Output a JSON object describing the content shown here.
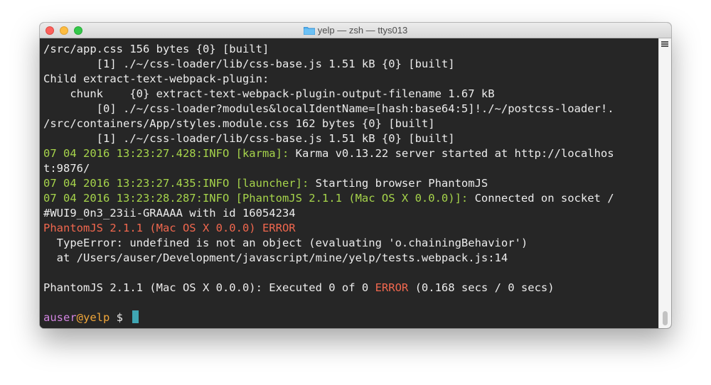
{
  "window": {
    "title": "yelp — zsh — ttys013",
    "colors": {
      "background": "#262626",
      "foreground": "#ececec",
      "green": "#a6d44b",
      "red": "#f0674e",
      "magenta": "#d184e0",
      "yellow": "#f0a63a",
      "cursor": "#3fa6b3"
    }
  },
  "terminal": {
    "lines": [
      [
        {
          "t": "/src/app.css 156 bytes {0} [built]"
        }
      ],
      [
        {
          "t": "        [1] ./~/css-loader/lib/css-base.js 1.51 kB {0} [built]"
        }
      ],
      [
        {
          "t": "Child extract-text-webpack-plugin:"
        }
      ],
      [
        {
          "t": "    chunk    {0} extract-text-webpack-plugin-output-filename 1.67 kB"
        }
      ],
      [
        {
          "t": "        [0] ./~/css-loader?modules&localIdentName=[hash:base64:5]!./~/postcss-loader!."
        }
      ],
      [
        {
          "t": "/src/containers/App/styles.module.css 162 bytes {0} [built]"
        }
      ],
      [
        {
          "t": "        [1] ./~/css-loader/lib/css-base.js 1.51 kB {0} [built]"
        }
      ],
      [
        {
          "t": "07 04 2016 13:23:27.428:INFO [karma]:",
          "c": "green"
        },
        {
          "t": " Karma v0.13.22 server started at http://localhos"
        }
      ],
      [
        {
          "t": "t:9876/"
        }
      ],
      [
        {
          "t": "07 04 2016 13:23:27.435:INFO [launcher]:",
          "c": "green"
        },
        {
          "t": " Starting browser PhantomJS"
        }
      ],
      [
        {
          "t": "07 04 2016 13:23:28.287:INFO [PhantomJS 2.1.1 (Mac OS X 0.0.0)]:",
          "c": "green"
        },
        {
          "t": " Connected on socket /"
        }
      ],
      [
        {
          "t": "#WUI9_0n3_23ii-GRAAAA with id 16054234"
        }
      ],
      [
        {
          "t": "PhantomJS 2.1.1 (Mac OS X 0.0.0) ERROR",
          "c": "red"
        }
      ],
      [
        {
          "t": "  TypeError: undefined is not an object (evaluating 'o.chainingBehavior')"
        }
      ],
      [
        {
          "t": "  at /Users/auser/Development/javascript/mine/yelp/tests.webpack.js:14"
        }
      ],
      [
        {
          "t": ""
        }
      ],
      [
        {
          "t": "PhantomJS 2.1.1 (Mac OS X 0.0.0): Executed 0 of 0 "
        },
        {
          "t": "ERROR",
          "c": "red"
        },
        {
          "t": " (0.168 secs / 0 secs)"
        }
      ],
      [
        {
          "t": ""
        }
      ]
    ],
    "prompt": {
      "user": "auser",
      "at": "@",
      "host": "yelp",
      "symbol": " $ "
    }
  }
}
